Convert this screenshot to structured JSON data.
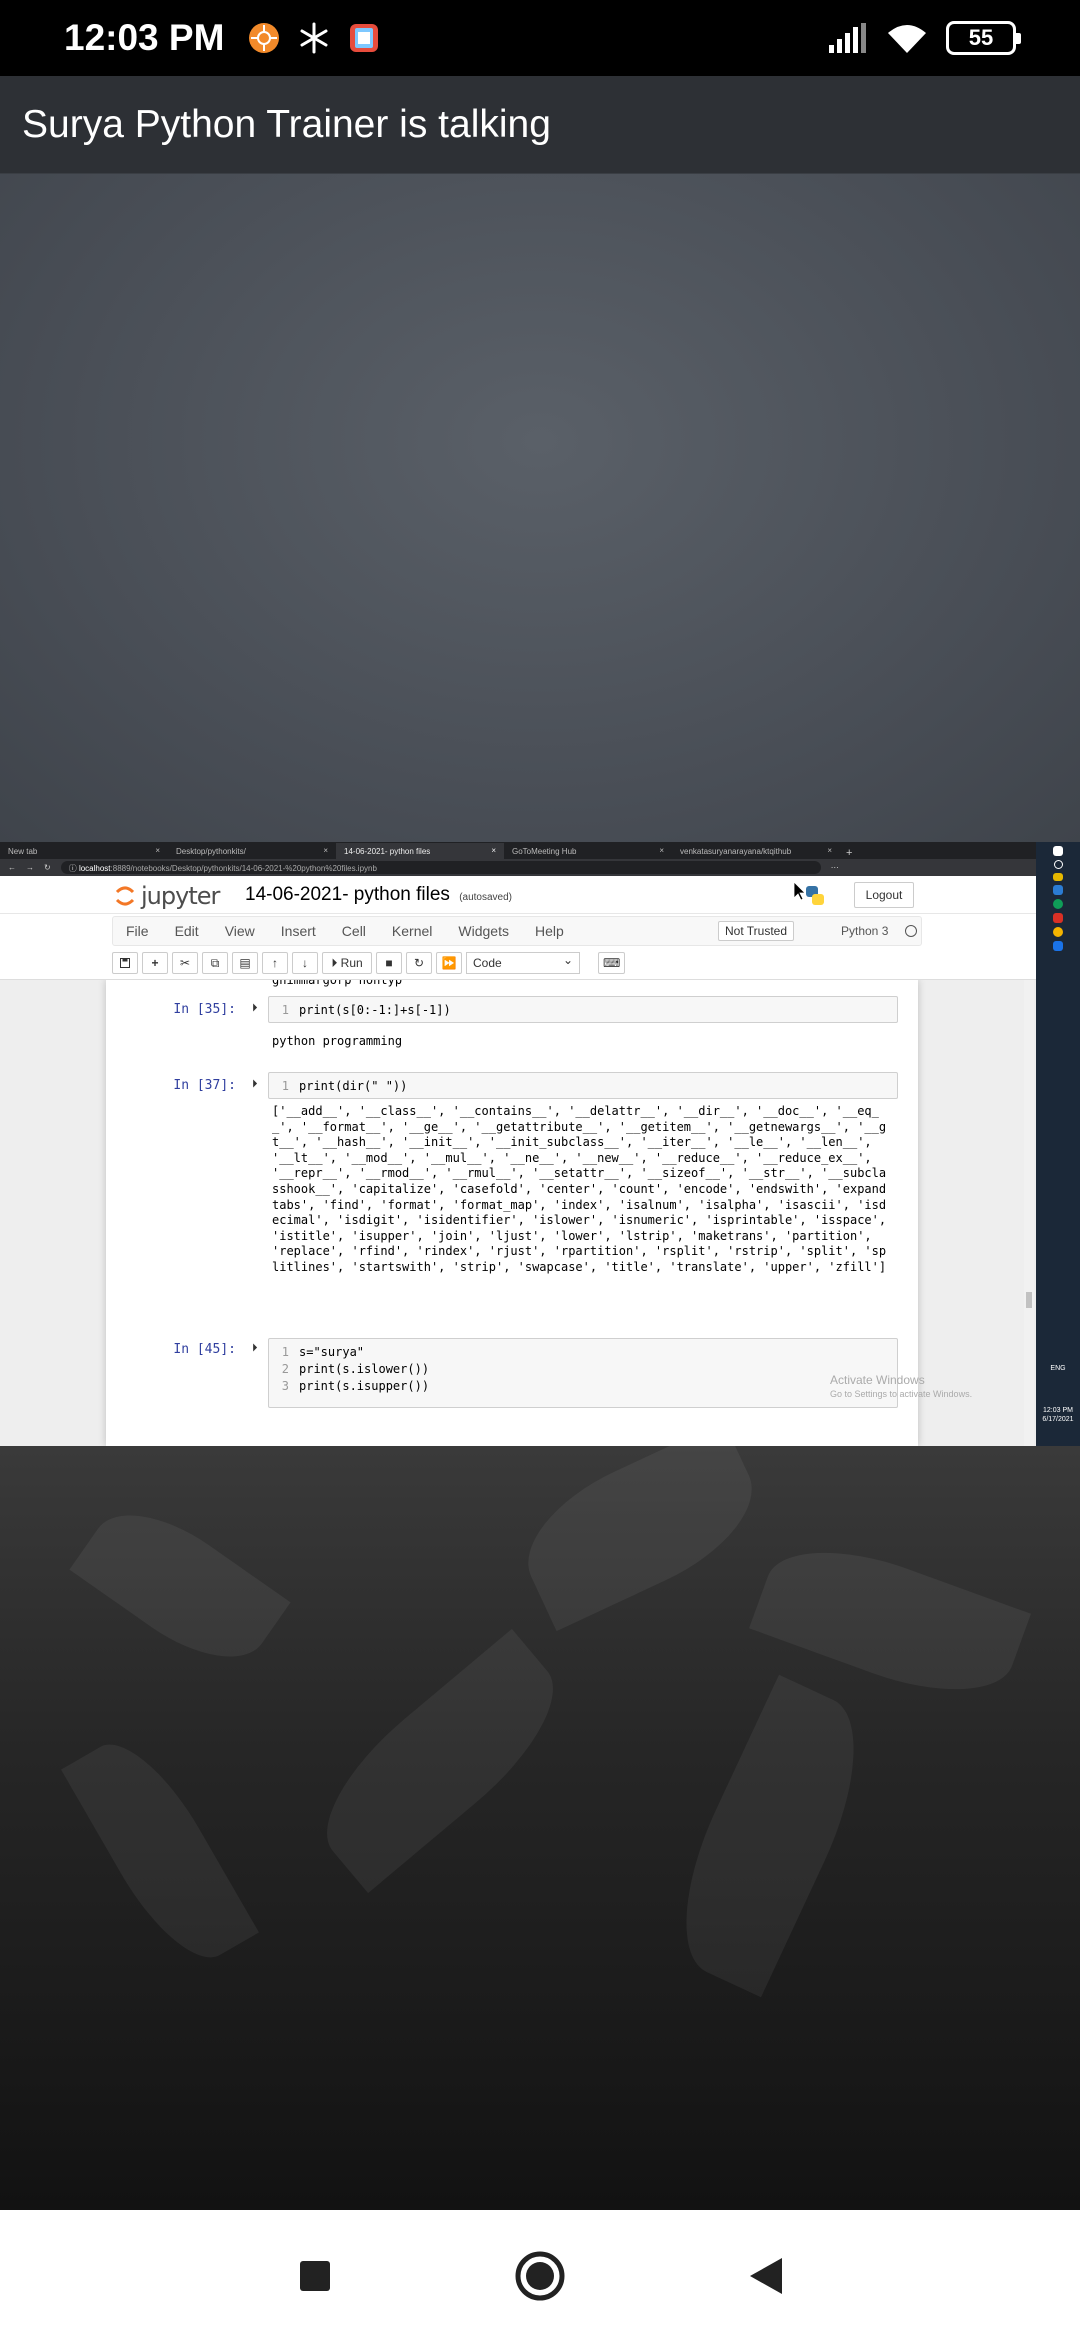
{
  "status": {
    "time": "12:03 PM",
    "battery": "55"
  },
  "meeting": {
    "title": "Surya Python Trainer is talking"
  },
  "browser": {
    "tabs": [
      "New tab",
      "Desktop/pythonkits/",
      "14-06-2021- python files",
      "GoToMeeting Hub",
      "venkatasuryanarayana/ktqithub"
    ],
    "url_host": "localhost",
    "url_path": ":8889/notebooks/Desktop/pythonkits/14-06-2021-%20python%20files.ipynb"
  },
  "jupyter": {
    "logo_text": "jupyter",
    "notebook_title": "14-06-2021- python files",
    "autosave": "(autosaved)",
    "logout_label": "Logout",
    "menu": [
      "File",
      "Edit",
      "View",
      "Insert",
      "Cell",
      "Kernel",
      "Widgets",
      "Help"
    ],
    "trust_label": "Not Trusted",
    "kernel_label": "Python 3",
    "run_label": "Run",
    "cell_type": "Code"
  },
  "cells": [
    {
      "prompt": "In [35]:",
      "lines": [
        "print(s[0:-1:]+s[-1])"
      ],
      "output": "python programming"
    },
    {
      "prompt": "In [37]:",
      "lines": [
        "print(dir(\" \"))"
      ],
      "output": "['__add__', '__class__', '__contains__', '__delattr__', '__dir__', '__doc__', '__eq__', '__format__', '__ge__', '__getattribute__', '__getitem__', '__getnewargs__', '__gt__', '__hash__', '__init__', '__init_subclass__', '__iter__', '__le__', '__len__', '__lt__', '__mod__', '__mul__', '__ne__', '__new__', '__reduce__', '__reduce_ex__', '__repr__', '__rmod__', '__rmul__', '__setattr__', '__sizeof__', '__str__', '__subclasshook__', 'capitalize', 'casefold', 'center', 'count', 'encode', 'endswith', 'expandtabs', 'find', 'format', 'format_map', 'index', 'isalnum', 'isalpha', 'isascii', 'isdecimal', 'isdigit', 'isidentifier', 'islower', 'isnumeric', 'isprintable', 'isspace', 'istitle', 'isupper', 'join', 'ljust', 'lower', 'lstrip', 'maketrans', 'partition', 'replace', 'rfind', 'rindex', 'rjust', 'rpartition', 'rsplit', 'rstrip', 'split', 'splitlines', 'startswith', 'strip', 'swapcase', 'title', 'translate', 'upper', 'zfill']"
    },
    {
      "prompt": "In [45]:",
      "lines": [
        "s=\"surya\"",
        "print(s.islower())",
        "print(s.isupper())"
      ]
    }
  ],
  "watermark": {
    "title": "Activate Windows",
    "sub": "Go to Settings to activate Windows."
  },
  "taskbar": {
    "lang": "ENG",
    "time": "12:03 PM",
    "date": "6/17/2021"
  },
  "colors": {
    "status_bg": "#000000",
    "header_bg": "#2d3035",
    "jupyter_prompt": "#303f9f"
  }
}
